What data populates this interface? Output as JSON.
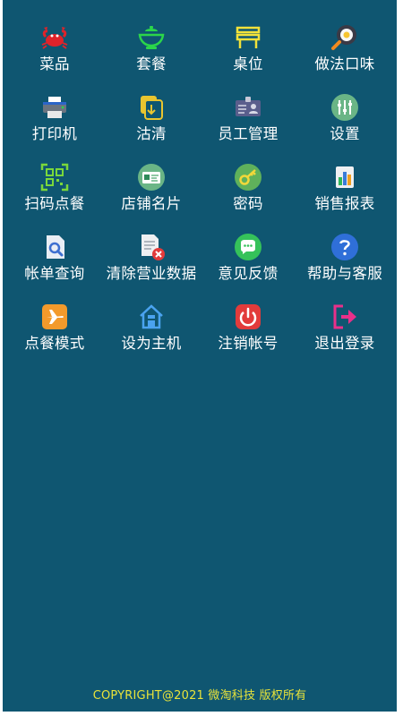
{
  "menu": {
    "items": [
      {
        "label": "菜品",
        "icon": "crab-icon"
      },
      {
        "label": "套餐",
        "icon": "bowl-icon"
      },
      {
        "label": "桌位",
        "icon": "table-icon"
      },
      {
        "label": "做法口味",
        "icon": "frying-pan-icon"
      },
      {
        "label": "打印机",
        "icon": "printer-icon"
      },
      {
        "label": "沽清",
        "icon": "clear-stock-icon"
      },
      {
        "label": "员工管理",
        "icon": "staff-badge-icon"
      },
      {
        "label": "设置",
        "icon": "sliders-icon"
      },
      {
        "label": "扫码点餐",
        "icon": "qr-code-icon"
      },
      {
        "label": "店铺名片",
        "icon": "business-card-icon"
      },
      {
        "label": "密码",
        "icon": "key-icon"
      },
      {
        "label": "销售报表",
        "icon": "bar-chart-icon"
      },
      {
        "label": "帐单查询",
        "icon": "bill-search-icon"
      },
      {
        "label": "清除营业数据",
        "icon": "clear-data-icon"
      },
      {
        "label": "意见反馈",
        "icon": "chat-bubble-icon"
      },
      {
        "label": "帮助与客服",
        "icon": "help-icon"
      },
      {
        "label": "点餐模式",
        "icon": "airplane-icon"
      },
      {
        "label": "设为主机",
        "icon": "home-icon"
      },
      {
        "label": "注销帐号",
        "icon": "power-icon"
      },
      {
        "label": "退出登录",
        "icon": "logout-icon"
      }
    ]
  },
  "footer": {
    "copyright": "COPYRIGHT@2021 微淘科技 版权所有"
  },
  "colors": {
    "background": "#0f5671",
    "label": "#ffffff",
    "footer_text": "#e8e33a"
  }
}
